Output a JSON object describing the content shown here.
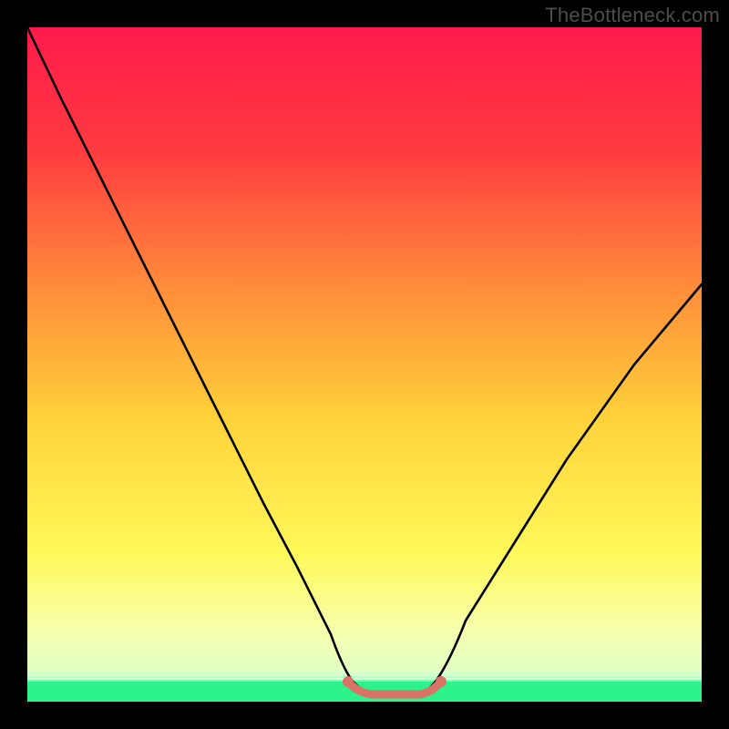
{
  "watermark": "TheBottleneck.com",
  "colors": {
    "frame_bg": "#000000",
    "watermark": "#4d4d4d",
    "curve_stroke": "#000000",
    "bottom_mark": "#d87366",
    "green_band": "#2cf28c",
    "gradient_top": "#ff1a4b",
    "gradient_mid1": "#ff6a3a",
    "gradient_mid2": "#ffd23a",
    "gradient_mid3": "#fff95a",
    "gradient_bottom": "#2cf28c"
  },
  "chart_data": {
    "type": "line",
    "title": "",
    "xlabel": "",
    "ylabel": "",
    "x": [
      0,
      5,
      10,
      15,
      20,
      25,
      30,
      35,
      40,
      45,
      48,
      50,
      52,
      55,
      58,
      60,
      65,
      70,
      75,
      80,
      85,
      90,
      95,
      100
    ],
    "values": [
      100,
      89,
      79,
      69,
      59,
      49,
      39,
      29,
      20,
      10,
      4,
      1,
      0,
      0,
      1,
      4,
      12,
      20,
      28,
      36,
      43,
      50,
      56,
      62
    ],
    "ylim": [
      0,
      100
    ],
    "xlim": [
      0,
      100
    ],
    "bottom_flat_range_x": [
      48,
      58
    ],
    "green_band_y_range": [
      0,
      4
    ],
    "notes": "V-shaped bottleneck curve over a vertical rainbow gradient; flat minimum marked with a red segment; thin green band at the very bottom."
  }
}
